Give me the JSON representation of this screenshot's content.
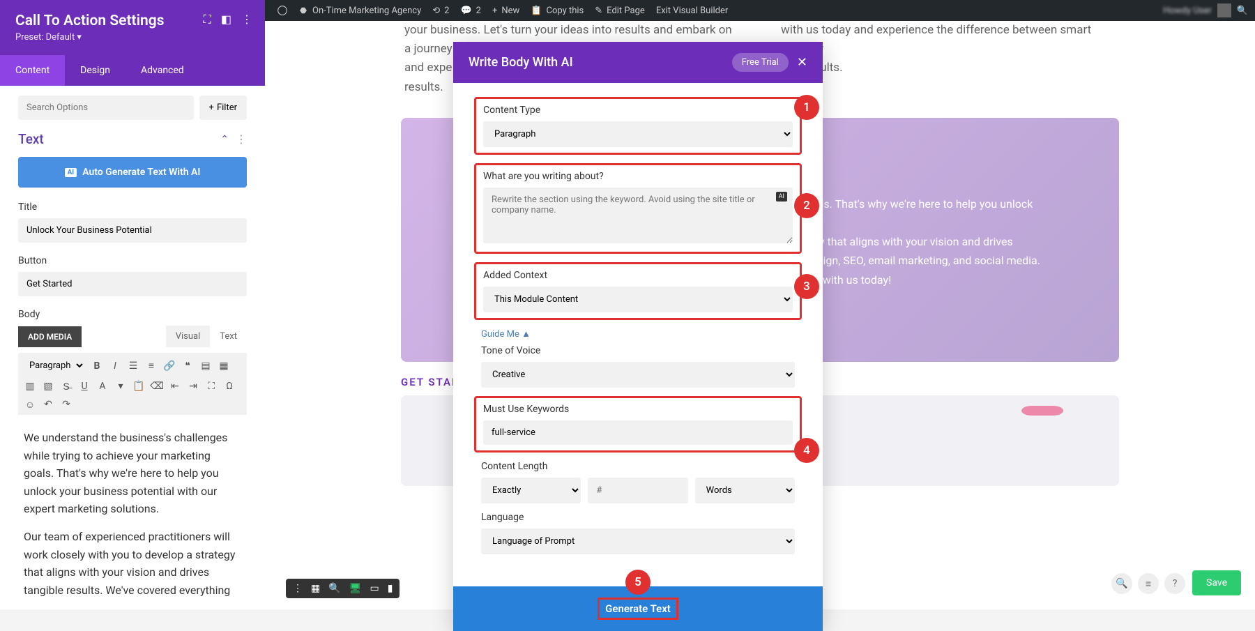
{
  "admin_bar": {
    "site": "On-Time Marketing Agency",
    "refresh": "2",
    "comments": "2",
    "new": "New",
    "copy": "Copy this",
    "edit": "Edit Page",
    "exit": "Exit Visual Builder"
  },
  "sidebar": {
    "title": "Call To Action Settings",
    "preset": "Preset: Default ▾",
    "tabs": {
      "content": "Content",
      "design": "Design",
      "advanced": "Advanced"
    },
    "search_placeholder": "Search Options",
    "filter": "Filter",
    "section": "Text",
    "ai_button": "Auto Generate Text With AI",
    "title_label": "Title",
    "title_value": "Unlock Your Business Potential",
    "button_label": "Button",
    "button_value": "Get Started",
    "body_label": "Body",
    "add_media": "ADD MEDIA",
    "visual": "Visual",
    "text": "Text",
    "para": "Paragraph",
    "body_p1": "We understand the business's challenges while trying to achieve your marketing goals. That's why we're here to help you unlock your business potential with our expert marketing solutions.",
    "body_p2": "Our team of experienced practitioners will work closely with you to develop a strategy that aligns with your vision and drives tangible results. We've covered everything"
  },
  "page": {
    "left_text": "your business. Let's turn your ideas into results and embark on a journey t",
    "left_text2": "and expe",
    "left_text3": "results.",
    "right_text": "with us today and experience the difference between smart strategy",
    "right_text2": "ong results.",
    "hero_text": "ing goals. That's why we're here to help you unlock",
    "hero_text2": "strategy that aligns with your vision and drives",
    "hero_text3": "y to design, SEO, email marketing, and social media.",
    "hero_text4": "started with us today!",
    "get_started": "GET STARTED"
  },
  "modal": {
    "title": "Write Body With AI",
    "free_trial": "Free Trial",
    "content_type_label": "Content Type",
    "content_type_value": "Paragraph",
    "writing_about_label": "What are you writing about?",
    "writing_about_placeholder": "Rewrite the section using the keyword. Avoid using the site title or company name.",
    "added_context_label": "Added Context",
    "added_context_value": "This Module Content",
    "guide_me": "Guide Me ▲",
    "tone_label": "Tone of Voice",
    "tone_value": "Creative",
    "keywords_label": "Must Use Keywords",
    "keywords_value": "full-service",
    "length_label": "Content Length",
    "length_mode": "Exactly",
    "length_num": "#",
    "length_unit": "Words",
    "language_label": "Language",
    "language_value": "Language of Prompt",
    "generate": "Generate Text",
    "callouts": {
      "c1": "1",
      "c2": "2",
      "c3": "3",
      "c4": "4",
      "c5": "5"
    }
  },
  "save": "Save"
}
